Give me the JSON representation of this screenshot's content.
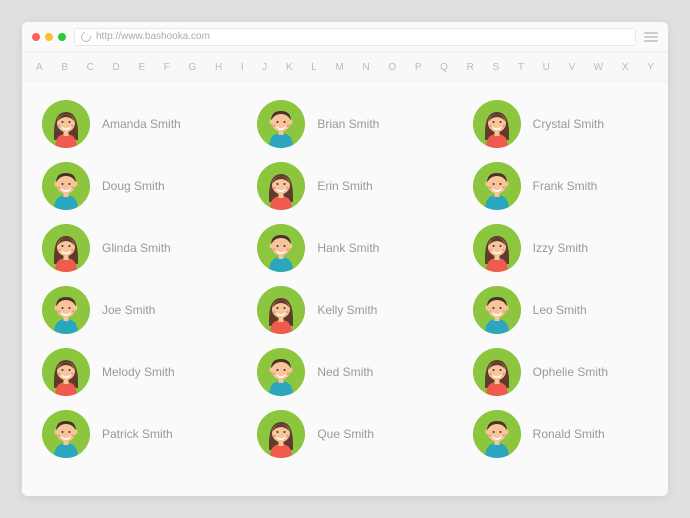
{
  "browser": {
    "url": "http://www.bashooka.com"
  },
  "alphabet": [
    "A",
    "B",
    "C",
    "D",
    "E",
    "F",
    "G",
    "H",
    "I",
    "J",
    "K",
    "L",
    "M",
    "N",
    "O",
    "P",
    "Q",
    "R",
    "S",
    "T",
    "U",
    "V",
    "W",
    "X",
    "Y"
  ],
  "contacts": [
    {
      "name": "Amanda Smith",
      "gender": "f"
    },
    {
      "name": "Brian Smith",
      "gender": "m"
    },
    {
      "name": "Crystal Smith",
      "gender": "f"
    },
    {
      "name": "Doug Smith",
      "gender": "m"
    },
    {
      "name": "Erin Smith",
      "gender": "f"
    },
    {
      "name": "Frank Smith",
      "gender": "m"
    },
    {
      "name": "Glinda Smith",
      "gender": "f"
    },
    {
      "name": "Hank Smith",
      "gender": "m"
    },
    {
      "name": "Izzy Smith",
      "gender": "f"
    },
    {
      "name": "Joe Smith",
      "gender": "m"
    },
    {
      "name": "Kelly Smith",
      "gender": "f"
    },
    {
      "name": "Leo Smith",
      "gender": "m"
    },
    {
      "name": "Melody Smith",
      "gender": "f"
    },
    {
      "name": "Ned Smith",
      "gender": "m"
    },
    {
      "name": "Ophelie Smith",
      "gender": "f"
    },
    {
      "name": "Patrick Smith",
      "gender": "m"
    },
    {
      "name": "Que Smith",
      "gender": "f"
    },
    {
      "name": "Ronald Smith",
      "gender": "m"
    }
  ],
  "colors": {
    "avatar_bg": "#8cc63f",
    "skin": "#f8c49a",
    "hair_f": "#5e3b2c",
    "shirt_f": "#ef5b4c",
    "hair_m": "#4a3328",
    "shirt_m": "#2aa7bf"
  }
}
